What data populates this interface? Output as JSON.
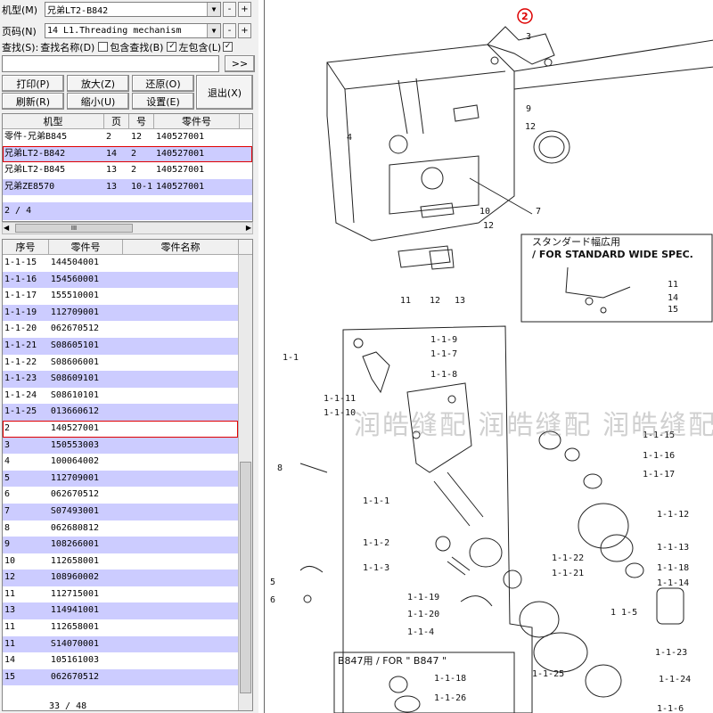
{
  "controls": {
    "model_label": "机型(M)",
    "model_value": "兄弟LT2-B842",
    "page_label": "页码(N)",
    "page_value": "14 L1.Threading mechanism",
    "search_label": "查找(S):",
    "search_name_label": "查找名称(D)",
    "include_search_label": "包含查找(B)",
    "left_include_label": "左包含(L)",
    "minus": "-",
    "plus": "+",
    "go": ">>",
    "search_value": ""
  },
  "buttons": {
    "print": "打印(P)",
    "zoom_in": "放大(Z)",
    "restore": "还原(O)",
    "refresh": "刷新(R)",
    "zoom_out": "缩小(U)",
    "settings": "设置(E)",
    "exit": "退出(X)"
  },
  "model_table": {
    "headers": [
      "机型",
      "页",
      "号",
      "零件号"
    ],
    "rows": [
      [
        "零件-兄弟B845",
        "2",
        "12",
        "140527001"
      ],
      [
        "兄弟LT2-B842",
        "14",
        "2",
        "140527001"
      ],
      [
        "兄弟LT2-B845",
        "13",
        "2",
        "140527001"
      ],
      [
        "兄弟ZE8570",
        "13",
        "10-1",
        "140527001"
      ]
    ],
    "selected_index": 1,
    "count": "2 / 4"
  },
  "parts_table": {
    "headers": [
      "序号",
      "零件号",
      "零件名称"
    ],
    "rows": [
      [
        "1-1-15",
        "144504001",
        ""
      ],
      [
        "1-1-16",
        "154560001",
        ""
      ],
      [
        "1-1-17",
        "155510001",
        ""
      ],
      [
        "1-1-19",
        "112709001",
        ""
      ],
      [
        "1-1-20",
        "062670512",
        ""
      ],
      [
        "1-1-21",
        "S08605101",
        ""
      ],
      [
        "1-1-22",
        "S08606001",
        ""
      ],
      [
        "1-1-23",
        "S08609101",
        ""
      ],
      [
        "1-1-24",
        "S08610101",
        ""
      ],
      [
        "1-1-25",
        "013660612",
        ""
      ],
      [
        "2",
        "140527001",
        ""
      ],
      [
        "3",
        "150553003",
        ""
      ],
      [
        "4",
        "100064002",
        ""
      ],
      [
        "5",
        "112709001",
        ""
      ],
      [
        "6",
        "062670512",
        ""
      ],
      [
        "7",
        "S07493001",
        ""
      ],
      [
        "8",
        "062680812",
        ""
      ],
      [
        "9",
        "108266001",
        ""
      ],
      [
        "10",
        "112658001",
        ""
      ],
      [
        "12",
        "108960002",
        ""
      ],
      [
        "11",
        "112715001",
        ""
      ],
      [
        "13",
        "114941001",
        ""
      ],
      [
        "11",
        "112658001",
        ""
      ],
      [
        "11",
        "S14070001",
        ""
      ],
      [
        "14",
        "105161003",
        ""
      ],
      [
        "15",
        "062670512",
        ""
      ]
    ],
    "selected_index": 10,
    "count": "33 / 48"
  },
  "diagram": {
    "highlight_callout": "2",
    "watermark": "润皓缝配  润皓缝配  润皓缝配",
    "spec_box_title": "スタンダード幅広用",
    "spec_box_subtitle": "/ FOR STANDARD WIDE SPEC.",
    "b847_box_title": "B847用 / FOR \" B847 \"",
    "callouts_top": [
      "3",
      "4",
      "9",
      "12",
      "10",
      "7",
      "12",
      "11",
      "12",
      "13"
    ],
    "callouts_spec": [
      "11",
      "14",
      "15"
    ],
    "callouts_mid": [
      "1-1",
      "1-1-9",
      "1-1-7",
      "1-1-8",
      "1-1-11",
      "1-1-10",
      "1-1-15",
      "1-1-16",
      "1-1-17",
      "8",
      "1-1-1",
      "1-1-12",
      "1-1-13",
      "1-1-2",
      "1-1-22",
      "1-1-3",
      "1-1-21",
      "1-1-18",
      "5",
      "1-1-14",
      "6",
      "1-1-19",
      "1-1-20",
      "1 1-5",
      "1-1-4",
      "1-1-23",
      "1-1-25",
      "1-1-24"
    ],
    "callouts_b847": [
      "1-1-18",
      "1-1-26",
      "1-1-6"
    ]
  }
}
